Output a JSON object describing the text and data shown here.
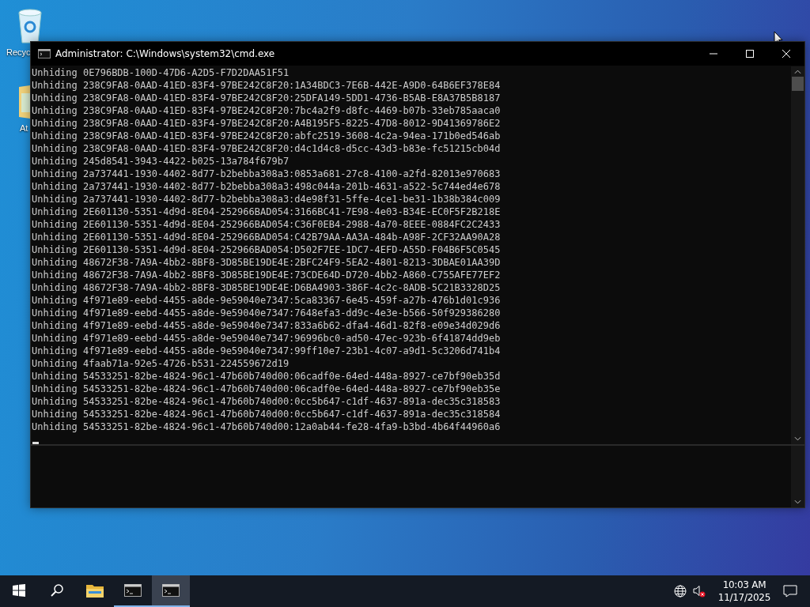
{
  "desktop": {
    "icons": [
      {
        "kind": "recycle-bin",
        "label": "Recyc"
      },
      {
        "kind": "folder",
        "label": "At"
      }
    ]
  },
  "window": {
    "title": "Administrator: C:\\Windows\\system32\\cmd.exe"
  },
  "console": {
    "lines": [
      "Unhiding 0E796BDB-100D-47D6-A2D5-F7D2DAA51F51",
      "Unhiding 238C9FA8-0AAD-41ED-83F4-97BE242C8F20:1A34BDC3-7E6B-442E-A9D0-64B6EF378E84",
      "Unhiding 238C9FA8-0AAD-41ED-83F4-97BE242C8F20:25DFA149-5DD1-4736-B5AB-E8A37B5B8187",
      "Unhiding 238C9FA8-0AAD-41ED-83F4-97BE242C8F20:7bc4a2f9-d8fc-4469-b07b-33eb785aaca0",
      "Unhiding 238C9FA8-0AAD-41ED-83F4-97BE242C8F20:A4B195F5-8225-47D8-8012-9D41369786E2",
      "Unhiding 238C9FA8-0AAD-41ED-83F4-97BE242C8F20:abfc2519-3608-4c2a-94ea-171b0ed546ab",
      "Unhiding 238C9FA8-0AAD-41ED-83F4-97BE242C8F20:d4c1d4c8-d5cc-43d3-b83e-fc51215cb04d",
      "Unhiding 245d8541-3943-4422-b025-13a784f679b7",
      "Unhiding 2a737441-1930-4402-8d77-b2bebba308a3:0853a681-27c8-4100-a2fd-82013e970683",
      "Unhiding 2a737441-1930-4402-8d77-b2bebba308a3:498c044a-201b-4631-a522-5c744ed4e678",
      "Unhiding 2a737441-1930-4402-8d77-b2bebba308a3:d4e98f31-5ffe-4ce1-be31-1b38b384c009",
      "Unhiding 2E601130-5351-4d9d-8E04-252966BAD054:3166BC41-7E98-4e03-B34E-EC0F5F2B218E",
      "Unhiding 2E601130-5351-4d9d-8E04-252966BAD054:C36F0EB4-2988-4a70-8EEE-0884FC2C2433",
      "Unhiding 2E601130-5351-4d9d-8E04-252966BAD054:C42B79AA-AA3A-484b-A98F-2CF32AA90A28",
      "Unhiding 2E601130-5351-4d9d-8E04-252966BAD054:D502F7EE-1DC7-4EFD-A55D-F04B6F5C0545",
      "Unhiding 48672F38-7A9A-4bb2-8BF8-3D85BE19DE4E:2BFC24F9-5EA2-4801-8213-3DBAE01AA39D",
      "Unhiding 48672F38-7A9A-4bb2-8BF8-3D85BE19DE4E:73CDE64D-D720-4bb2-A860-C755AFE77EF2",
      "Unhiding 48672F38-7A9A-4bb2-8BF8-3D85BE19DE4E:D6BA4903-386F-4c2c-8ADB-5C21B3328D25",
      "Unhiding 4f971e89-eebd-4455-a8de-9e59040e7347:5ca83367-6e45-459f-a27b-476b1d01c936",
      "Unhiding 4f971e89-eebd-4455-a8de-9e59040e7347:7648efa3-dd9c-4e3e-b566-50f929386280",
      "Unhiding 4f971e89-eebd-4455-a8de-9e59040e7347:833a6b62-dfa4-46d1-82f8-e09e34d029d6",
      "Unhiding 4f971e89-eebd-4455-a8de-9e59040e7347:96996bc0-ad50-47ec-923b-6f41874dd9eb",
      "Unhiding 4f971e89-eebd-4455-a8de-9e59040e7347:99ff10e7-23b1-4c07-a9d1-5c3206d741b4",
      "Unhiding 4faab71a-92e5-4726-b531-224559672d19",
      "Unhiding 54533251-82be-4824-96c1-47b60b740d00:06cadf0e-64ed-448a-8927-ce7bf90eb35d",
      "Unhiding 54533251-82be-4824-96c1-47b60b740d00:06cadf0e-64ed-448a-8927-ce7bf90eb35e",
      "Unhiding 54533251-82be-4824-96c1-47b60b740d00:0cc5b647-c1df-4637-891a-dec35c318583",
      "Unhiding 54533251-82be-4824-96c1-47b60b740d00:0cc5b647-c1df-4637-891a-dec35c318584",
      "Unhiding 54533251-82be-4824-96c1-47b60b740d00:12a0ab44-fe28-4fa9-b3bd-4b64f44960a6"
    ]
  },
  "taskbar": {
    "items": [
      {
        "kind": "start",
        "selected": false
      },
      {
        "kind": "search",
        "selected": false
      },
      {
        "kind": "explorer",
        "selected": false
      },
      {
        "kind": "console",
        "selected": false
      },
      {
        "kind": "console",
        "selected": true
      }
    ],
    "clock": {
      "time": "10:03 AM",
      "date": "11/17/2025"
    }
  }
}
